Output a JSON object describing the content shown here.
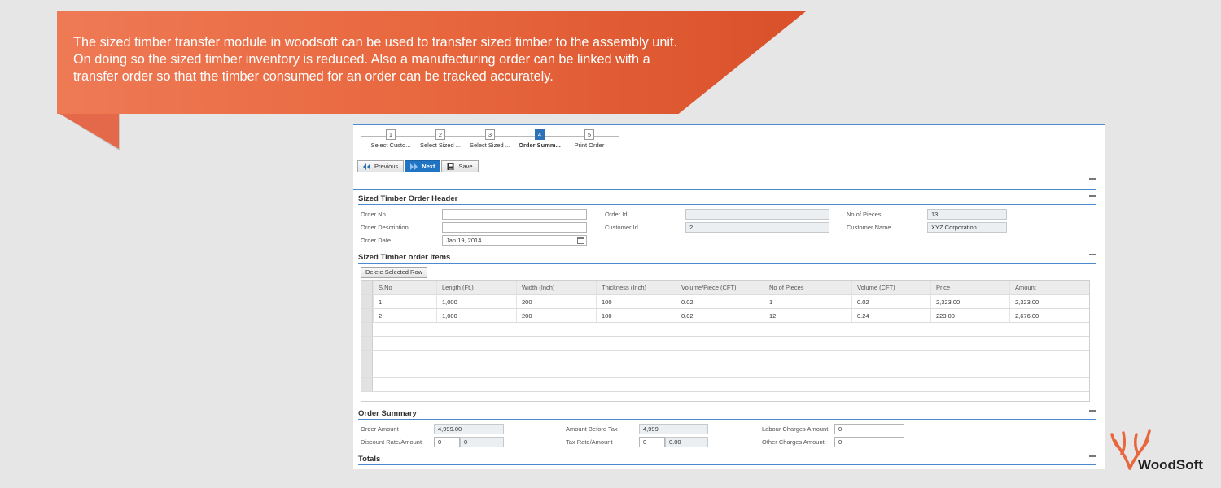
{
  "banner": {
    "text": "The sized timber transfer module in woodsoft can be used to transfer sized timber to the assembly unit.\n On doing so  the sized timber inventory is reduced. Also a manufacturing order can be linked with a\n transfer order so that the  timber consumed for an order can be tracked accurately.",
    "color": "#e8673e"
  },
  "wizard": {
    "steps": [
      {
        "num": "1",
        "label": "Select Custo..."
      },
      {
        "num": "2",
        "label": "Select Sized ..."
      },
      {
        "num": "3",
        "label": "Select Sized ..."
      },
      {
        "num": "4",
        "label": "Order Summ..."
      },
      {
        "num": "5",
        "label": "Print Order"
      }
    ],
    "active_step": "4"
  },
  "toolbar": {
    "previous": "Previous",
    "next": "Next",
    "save": "Save"
  },
  "header": {
    "title": "Sized Timber Order Header",
    "order_no_label": "Order No.",
    "order_no": "",
    "order_desc_label": "Order Description",
    "order_desc": "",
    "order_date_label": "Order Date",
    "order_date": "Jan 19, 2014",
    "order_id_label": "Order Id",
    "order_id": "",
    "customer_id_label": "Customer Id",
    "customer_id": "2",
    "pieces_label": "No of Pieces",
    "pieces": "13",
    "customer_name_label": "Customer Name",
    "customer_name": "XYZ Corporation"
  },
  "items": {
    "title": "Sized Timber order Items",
    "delete_label": "Delete Selected Row",
    "columns": [
      "S.No",
      "Length (Ft.)",
      "Width (Inch)",
      "Thickness (Inch)",
      "Volume/Piece (CFT)",
      "No of Pieces",
      "Volume (CFT)",
      "Price",
      "Amount"
    ],
    "rows": [
      [
        "1",
        "1,000",
        "200",
        "100",
        "0.02",
        "1",
        "0.02",
        "2,323.00",
        "2,323.00"
      ],
      [
        "2",
        "1,000",
        "200",
        "100",
        "0.02",
        "12",
        "0.24",
        "223.00",
        "2,676.00"
      ]
    ]
  },
  "summary": {
    "title": "Order Summary",
    "order_amount_label": "Order Amount",
    "order_amount": "4,999.00",
    "discount_label": "Discount Rate/Amount",
    "discount_rate": "0",
    "discount_amount": "0",
    "before_tax_label": "Amount Before Tax",
    "before_tax": "4,999",
    "tax_label": "Tax Rate/Amount",
    "tax_rate": "0",
    "tax_amount": "0.00",
    "labour_label": "Labour Charges Amount",
    "labour": "0",
    "other_label": "Other Charges Amount",
    "other": "0"
  },
  "totals": {
    "title": "Totals"
  },
  "logo": {
    "text": "WoodSoft",
    "accent": "#e8673e"
  },
  "colors": {
    "accent_blue": "#2c71b8",
    "rule_blue": "#4a8bd0"
  }
}
